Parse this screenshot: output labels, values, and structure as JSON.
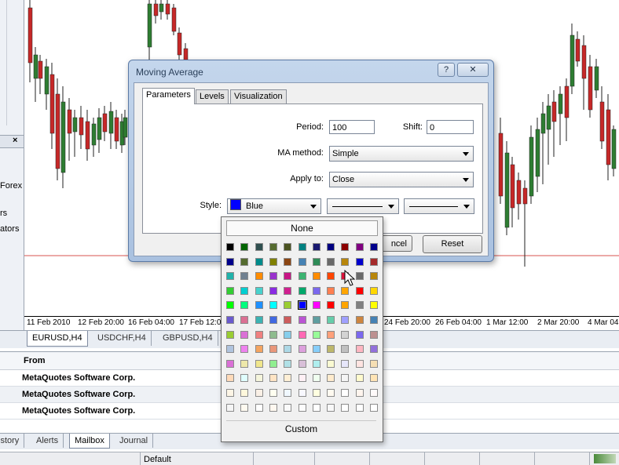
{
  "navigator": {
    "close_symbol": "×",
    "items": [
      "Forex",
      "rs",
      "ators"
    ]
  },
  "chart": {
    "time_labels": [
      "11 Feb 2010",
      "12 Feb 20:00",
      "16 Feb 04:00",
      "17 Feb 12:00",
      "24 Feb 20:00",
      "26 Feb 04:00",
      "1 Mar 12:00",
      "2 Mar 20:00",
      "4 Mar 04"
    ],
    "tabs": [
      "EURUSD,H4",
      "USDCHF,H4",
      "GBPUSD,H4"
    ],
    "bull_color": "#2e7d32",
    "bear_color": "#c62828",
    "level_color": "#d9534f"
  },
  "terminal": {
    "column_from": "From",
    "rows": [
      "MetaQuotes Software Corp.",
      "MetaQuotes Software Corp.",
      "MetaQuotes Software Corp."
    ],
    "tabs": [
      "istory",
      "Alerts",
      "Mailbox",
      "Journal"
    ],
    "status_text": "Default"
  },
  "dialog": {
    "title": "Moving Average",
    "help_label": "?",
    "close_label": "✕",
    "tabs": [
      "Parameters",
      "Levels",
      "Visualization"
    ],
    "period_label": "Period:",
    "period_value": "100",
    "shift_label": "Shift:",
    "shift_value": "0",
    "method_label": "MA method:",
    "method_value": "Simple",
    "apply_label": "Apply to:",
    "apply_value": "Close",
    "style_label": "Style:",
    "style_color_name": "Blue",
    "style_color": "#0000ff",
    "cancel_label": "ncel",
    "reset_label": "Reset"
  },
  "color_picker": {
    "none_label": "None",
    "custom_label": "Custom",
    "palette": [
      [
        "#000000",
        "#006400",
        "#2f4f4f",
        "#556b2f",
        "#4b5320",
        "#008080",
        "#191970",
        "#000080",
        "#8b0000",
        "#800080",
        "#00008b"
      ],
      [
        "#00008b",
        "#556b2f",
        "#008b8b",
        "#808000",
        "#8b4513",
        "#4682b4",
        "#2e8b57",
        "#696969",
        "#b8860b",
        "#0000cd",
        "#a52a2a"
      ],
      [
        "#20b2aa",
        "#708090",
        "#ff8c00",
        "#9932cc",
        "#c71585",
        "#3cb371",
        "#ff8c00",
        "#ff4500",
        "#dc143c",
        "#696969",
        "#b8860b"
      ],
      [
        "#32cd32",
        "#00ced1",
        "#48d1cc",
        "#8a2be2",
        "#d02090",
        "#00a86b",
        "#7b68ee",
        "#ff7f50",
        "#ffa500",
        "#ff0000",
        "#ffd700"
      ],
      [
        "#00ff00",
        "#00ff7f",
        "#1e90ff",
        "#00ffff",
        "#9acd32",
        "#0000ff",
        "#ff00ff",
        "#ff0000",
        "#ffa500",
        "#808080",
        "#ffff00"
      ],
      [
        "#6a5acd",
        "#db7093",
        "#3cb3b3",
        "#4169e1",
        "#cd5c5c",
        "#ba55d3",
        "#5f9ea0",
        "#66cdaa",
        "#a0a0ff",
        "#cd853f",
        "#4682b4"
      ],
      [
        "#9acd32",
        "#da70d6",
        "#f08080",
        "#8fbc8f",
        "#87ceeb",
        "#ff69b4",
        "#98fb98",
        "#ffa07a",
        "#d3d3d3",
        "#7b68ee",
        "#bc8f8f"
      ],
      [
        "#b0c4de",
        "#ee82ee",
        "#f4a460",
        "#e9967a",
        "#add8e6",
        "#dda0dd",
        "#87cefa",
        "#bdb76b",
        "#c0c0c0",
        "#ffb6c1",
        "#9370db"
      ],
      [
        "#da70d6",
        "#eee8aa",
        "#f0e68c",
        "#90ee90",
        "#b0e0e6",
        "#d8bfd8",
        "#afeeee",
        "#fafad2",
        "#e6e6fa",
        "#ffe4e1",
        "#f5deb3"
      ],
      [
        "#ffdab9",
        "#e0ffff",
        "#f5f5dc",
        "#ffe4c4",
        "#ffefd5",
        "#fff0f5",
        "#f0fff0",
        "#ffebcd",
        "#f5f5f5",
        "#fffacd",
        "#ffe4b5"
      ],
      [
        "#fdf5e6",
        "#fff8dc",
        "#faf0e6",
        "#fffff0",
        "#f0f8ff",
        "#f8f8ff",
        "#ffffe0",
        "#fffaf0",
        "#ffffff",
        "#fff5ee",
        "#fffafa"
      ],
      [
        "#f5f5f5",
        "#fffaf0",
        "#ffffff",
        "#fff8f0",
        "#fafafa",
        "#fcfcfc",
        "#ffffff",
        "#f8f8f8",
        "#ffffff",
        "#fefefe",
        "#ffffff"
      ]
    ]
  }
}
